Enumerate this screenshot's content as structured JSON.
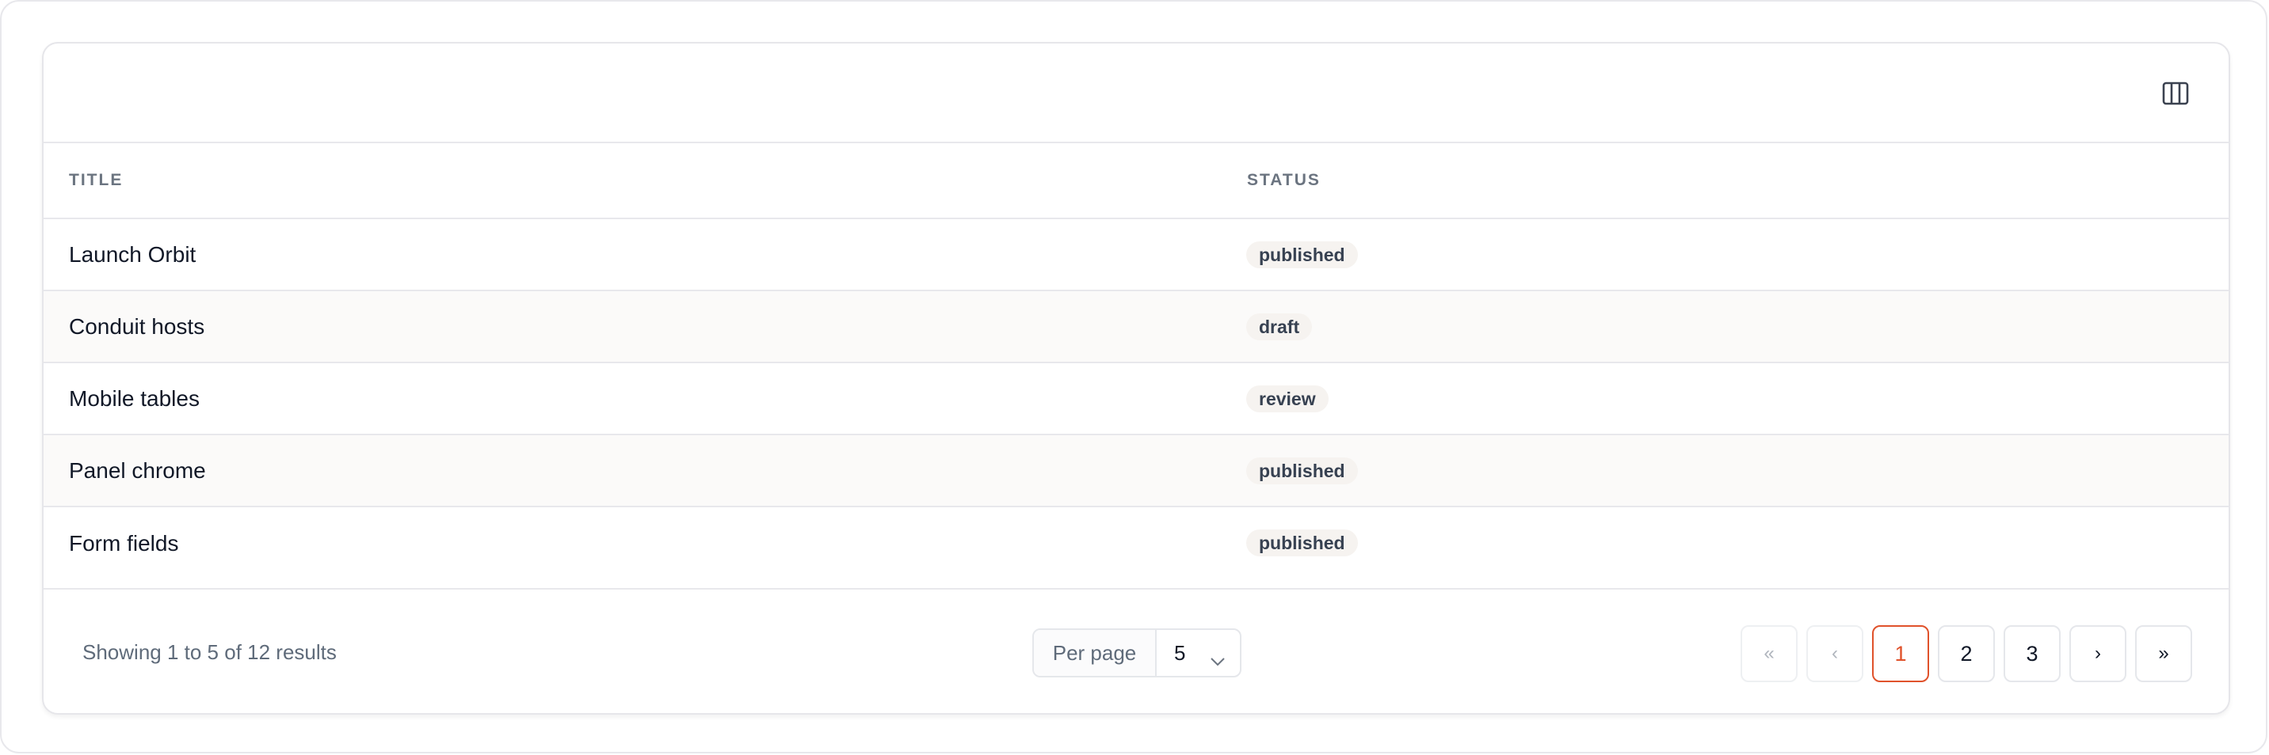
{
  "table": {
    "columns": [
      "Title",
      "Status"
    ],
    "rows": [
      {
        "title": "Launch Orbit",
        "status": "published"
      },
      {
        "title": "Conduit hosts",
        "status": "draft"
      },
      {
        "title": "Mobile tables",
        "status": "review"
      },
      {
        "title": "Panel chrome",
        "status": "published"
      },
      {
        "title": "Form fields",
        "status": "published"
      }
    ]
  },
  "toolbar": {
    "column_toggle_icon": "columns-icon"
  },
  "footer": {
    "summary": "Showing 1 to 5 of 12 results",
    "per_page_label": "Per page",
    "per_page_value": "5"
  },
  "pagination": {
    "first": "«",
    "prev": "‹",
    "pages": [
      "1",
      "2",
      "3"
    ],
    "current": "1",
    "next": "›",
    "last": "»"
  },
  "colors": {
    "accent": "#e0522b",
    "badge_bg": "#f6f3f0",
    "row_alt_bg": "#fbfaf9"
  }
}
